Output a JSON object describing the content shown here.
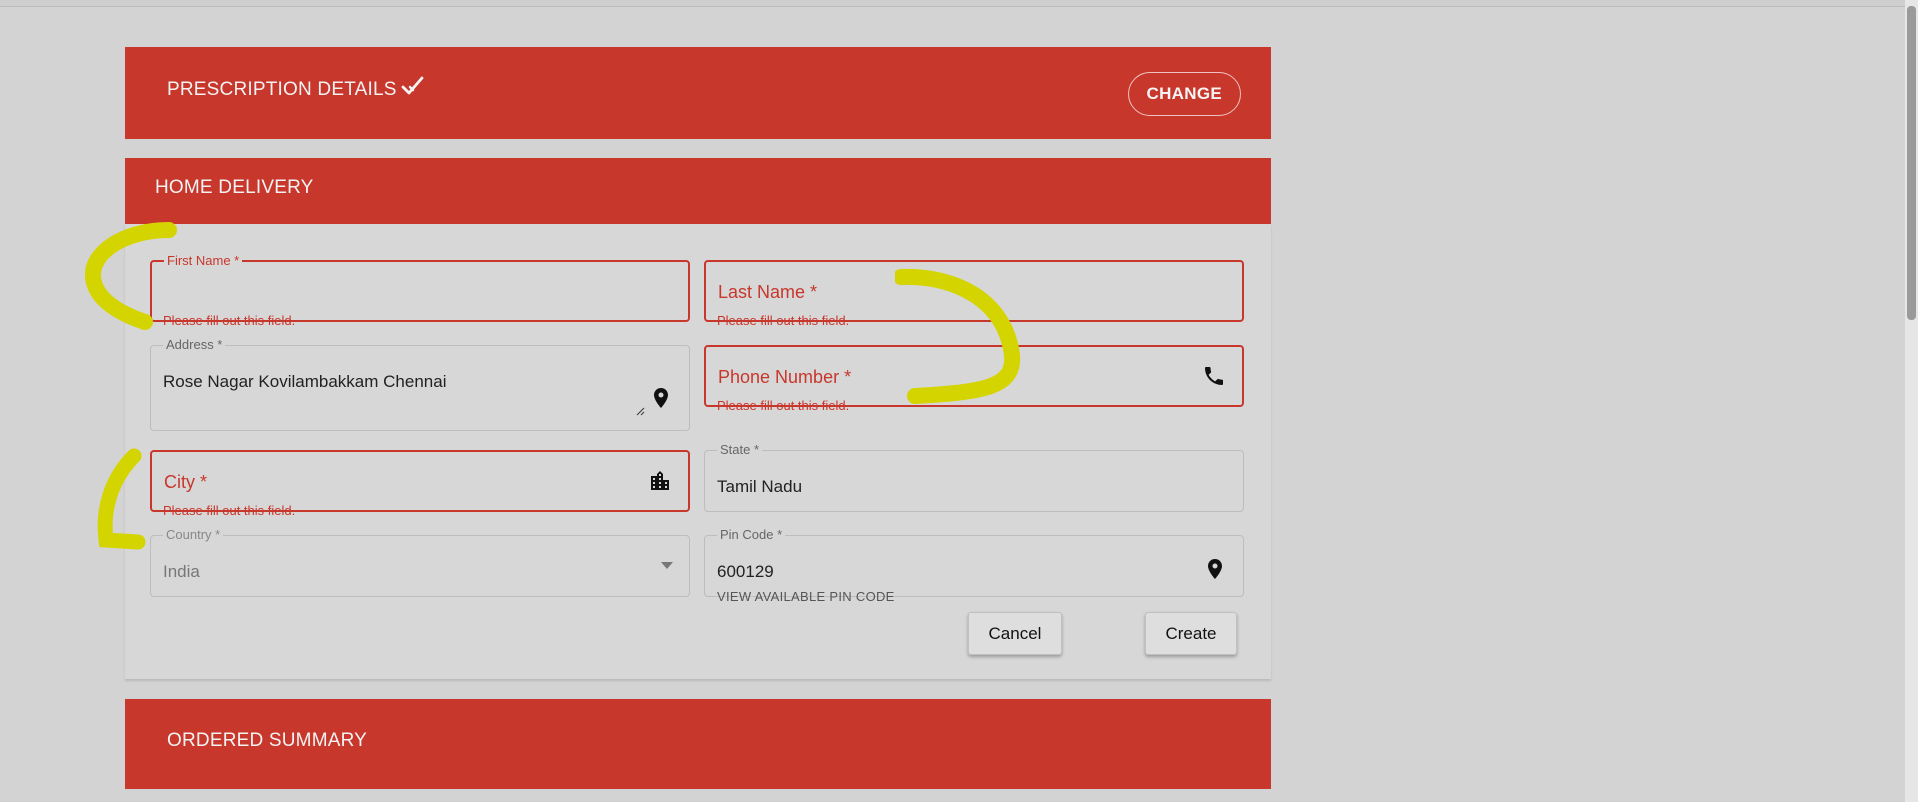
{
  "prescription": {
    "title": "PRESCRIPTION DETAILS",
    "change_label": "CHANGE"
  },
  "home_delivery": {
    "title": "HOME DELIVERY"
  },
  "form": {
    "first_name": {
      "label": "First Name *",
      "error": "Please fill out this field."
    },
    "last_name": {
      "placeholder": "Last Name *",
      "error": "Please fill out this field."
    },
    "address": {
      "label": "Address *",
      "value": "Rose Nagar Kovilambakkam Chennai"
    },
    "phone": {
      "placeholder": "Phone Number *",
      "error": "Please fill out this field."
    },
    "city": {
      "placeholder": "City *",
      "error": "Please fill out this field."
    },
    "state": {
      "label": "State *",
      "value": "Tamil Nadu"
    },
    "country": {
      "label": "Country *",
      "value": "India"
    },
    "pincode": {
      "label": "Pin Code *",
      "value": "600129",
      "helper": "VIEW AVAILABLE PIN CODE"
    }
  },
  "actions": {
    "cancel_label": "Cancel",
    "create_label": "Create"
  },
  "ordered_summary": {
    "title": "ORDERED SUMMARY"
  },
  "colors": {
    "accent": "#c8372c",
    "highlight": "#d4d400",
    "background": "#d3d3d3"
  }
}
